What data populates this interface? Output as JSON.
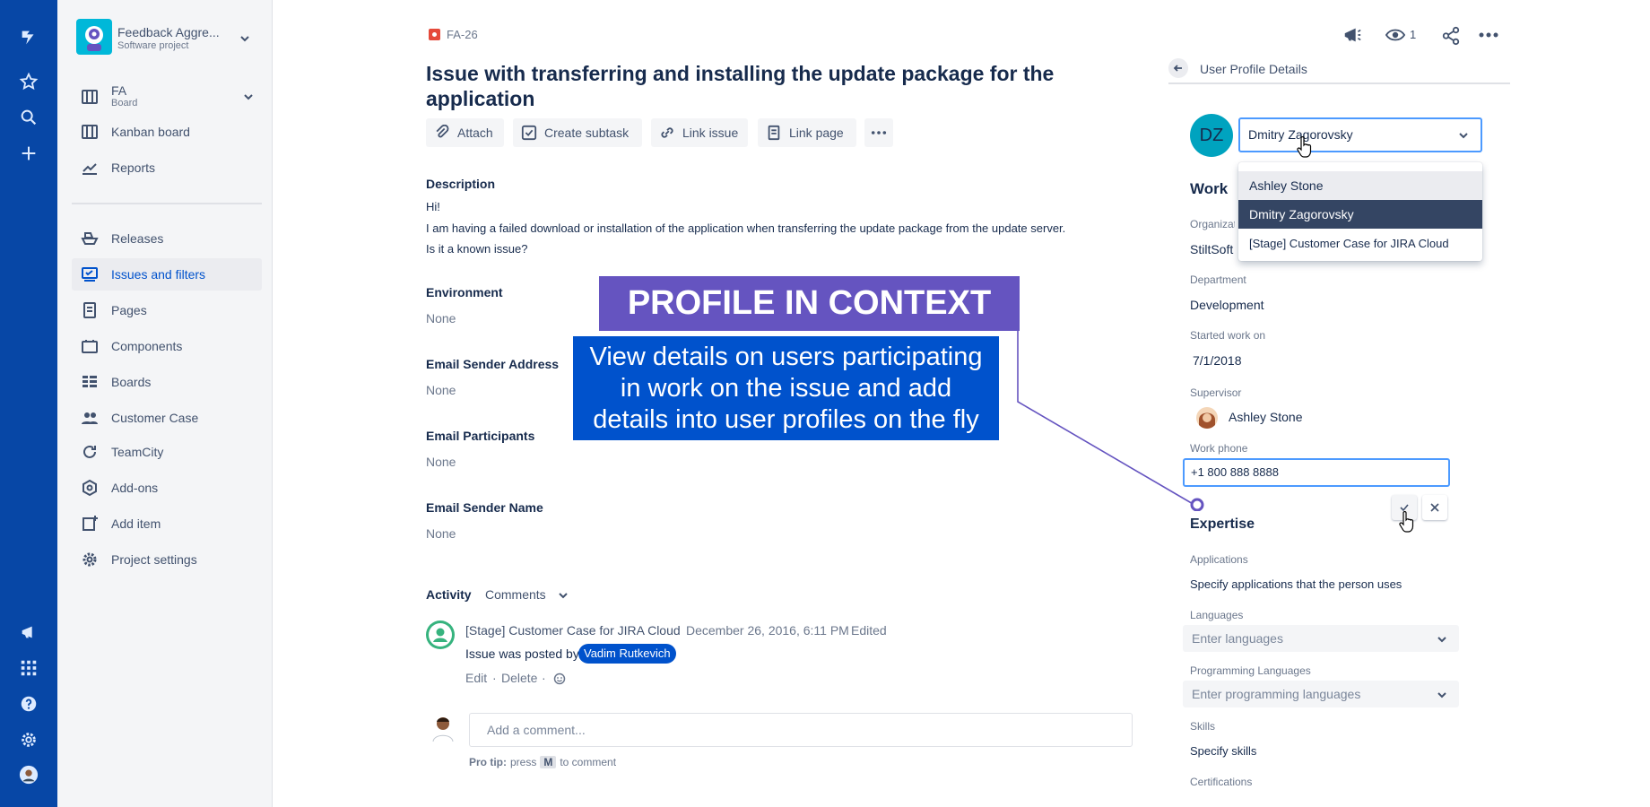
{
  "sidebar": {
    "project_name": "Feedback Aggre...",
    "project_type": "Software project",
    "board_name": "FA",
    "board_sub": "Board",
    "items": [
      {
        "label": "Kanban board"
      },
      {
        "label": "Reports"
      },
      {
        "label": "Releases"
      },
      {
        "label": "Issues and filters"
      },
      {
        "label": "Pages"
      },
      {
        "label": "Components"
      },
      {
        "label": "Boards"
      },
      {
        "label": "Customer Case"
      },
      {
        "label": "TeamCity"
      },
      {
        "label": "Add-ons"
      },
      {
        "label": "Add item"
      },
      {
        "label": "Project settings"
      }
    ]
  },
  "issue": {
    "key": "FA-26",
    "title_line1": "Issue with transferring and installing the update package for the",
    "title_line2": "application",
    "watch_count": "1",
    "actions": {
      "attach": "Attach",
      "create_subtask": "Create subtask",
      "link_issue": "Link issue",
      "link_page": "Link page"
    },
    "description_label": "Description",
    "description_lines": [
      "Hi!",
      "I am having a failed download or installation of the application when transferring the update package from the update server.",
      "Is it a known issue?"
    ],
    "fields": [
      {
        "label": "Environment",
        "value": "None"
      },
      {
        "label": "Email Sender Address",
        "value": "None"
      },
      {
        "label": "Email Participants",
        "value": "None"
      },
      {
        "label": "Email Sender Name",
        "value": "None"
      }
    ],
    "activity": {
      "label": "Activity",
      "filter": "Comments",
      "author": "[Stage] Customer Case for JIRA Cloud",
      "date": "December 26, 2016, 6:11 PM",
      "edited": "Edited",
      "body_prefix": "Issue was posted by",
      "mention": "Vadim Rutkevich",
      "edit": "Edit",
      "delete": "Delete",
      "sep": "·"
    },
    "comment_placeholder": "Add a comment...",
    "pro_tip_label": "Pro tip:",
    "pro_tip_press": "press",
    "pro_tip_key": "M",
    "pro_tip_suffix": "to comment"
  },
  "promo": {
    "title": "PROFILE IN CONTEXT",
    "line1": "View details on users participating",
    "line2": "in work on the issue and add",
    "line3": "details into user profiles on the fly"
  },
  "profile_panel": {
    "header": "User Profile Details",
    "avatar_initials": "DZ",
    "selected_user": "Dmitry Zagorovsky",
    "dropdown_options": [
      "Ashley Stone",
      "Dmitry Zagorovsky",
      "[Stage] Customer Case for JIRA Cloud"
    ],
    "work_heading": "Work",
    "organization_label": "Organization",
    "organization_value": "StiltSoft",
    "department_label": "Department",
    "department_value": "Development",
    "started_label": "Started work on",
    "started_value": "7/1/2018",
    "supervisor_label": "Supervisor",
    "supervisor_value": "Ashley Stone",
    "phone_label": "Work phone",
    "phone_value": "+1 800 888 8888",
    "expertise_heading": "Expertise",
    "applications_label": "Applications",
    "applications_value": "Specify applications that the person uses",
    "languages_label": "Languages",
    "languages_placeholder": "Enter languages",
    "prog_label": "Programming Languages",
    "prog_placeholder": "Enter programming languages",
    "skills_label": "Skills",
    "skills_value": "Specify skills",
    "certs_label": "Certifications"
  },
  "colors": {
    "rail": "#0747a6",
    "accent": "#0052cc",
    "promo_title_bg": "#6554c0",
    "promo_body_bg": "#0052cc",
    "dropdown_selected_bg": "#344563"
  }
}
